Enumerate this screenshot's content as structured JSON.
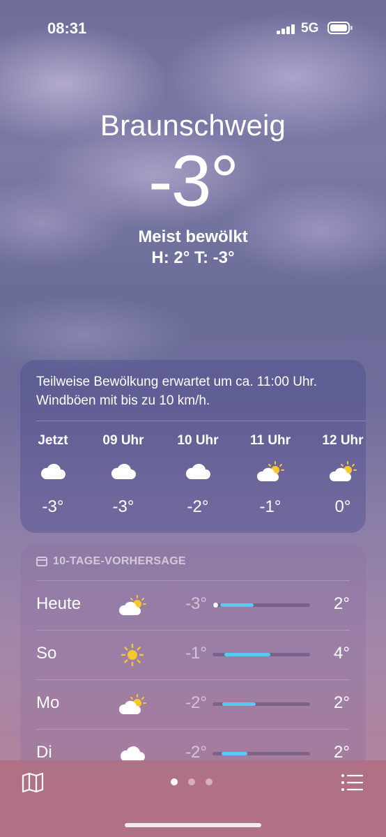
{
  "status_bar": {
    "time": "08:31",
    "network": "5G"
  },
  "current": {
    "city": "Braunschweig",
    "temperature": "-3°",
    "condition": "Meist bewölkt",
    "high_low": "H: 2°  T: -3°"
  },
  "hourly": {
    "summary": "Teilweise Bewölkung erwartet um ca. 11:00 Uhr. Windböen mit bis zu 10 km/h.",
    "items": [
      {
        "label": "Jetzt",
        "icon": "cloud-icon",
        "temp": "-3°"
      },
      {
        "label": "09 Uhr",
        "icon": "cloud-icon",
        "temp": "-3°"
      },
      {
        "label": "10 Uhr",
        "icon": "cloud-icon",
        "temp": "-2°"
      },
      {
        "label": "11 Uhr",
        "icon": "partly-sunny-icon",
        "temp": "-1°"
      },
      {
        "label": "12 Uhr",
        "icon": "partly-sunny-icon",
        "temp": "0°"
      }
    ]
  },
  "forecast": {
    "header": "10-TAGE-VORHERSAGE",
    "days": [
      {
        "day": "Heute",
        "icon": "partly-sunny-icon",
        "low": "-3°",
        "high": "2°",
        "range_start": 0.08,
        "range_end": 0.42,
        "current_marker": 0.03
      },
      {
        "day": "So",
        "icon": "sun-icon",
        "low": "-1°",
        "high": "4°",
        "range_start": 0.12,
        "range_end": 0.59
      },
      {
        "day": "Mo",
        "icon": "partly-sunny-icon",
        "low": "-2°",
        "high": "2°",
        "range_start": 0.1,
        "range_end": 0.44
      },
      {
        "day": "Di",
        "icon": "cloud-icon",
        "low": "-2°",
        "high": "2°",
        "range_start": 0.09,
        "range_end": 0.36
      }
    ]
  },
  "bottom_bar": {
    "pages": 3,
    "active_page": 0
  },
  "colors": {
    "bar_fill": "#5ac8f5",
    "sun": "#f7c72b"
  }
}
